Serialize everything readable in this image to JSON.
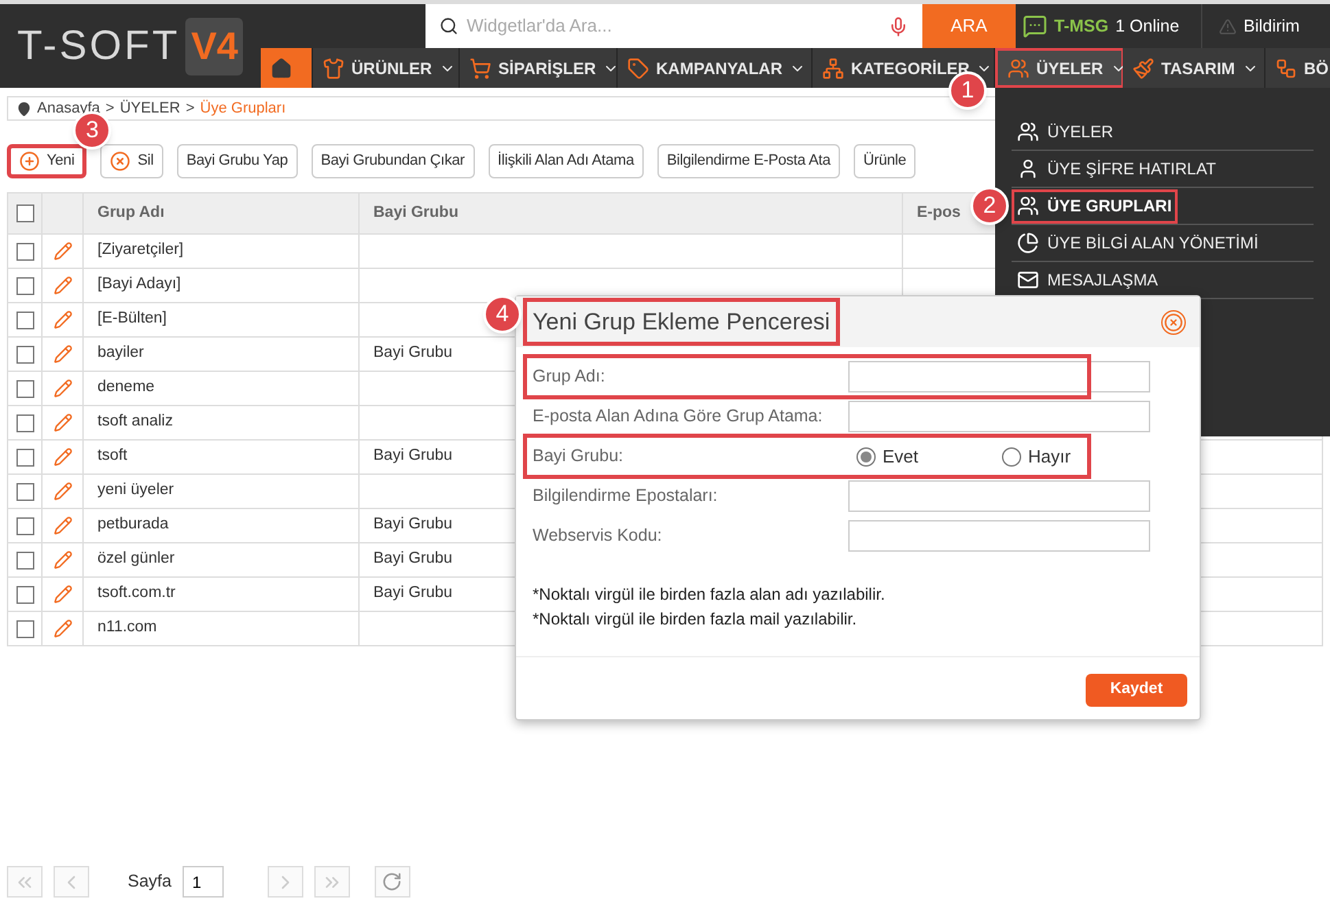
{
  "header": {
    "logo": {
      "text": "T-SOFT",
      "version": "V4"
    },
    "search": {
      "placeholder": "Widgetlar'da Ara..."
    },
    "search_button": "ARA",
    "messages": {
      "label": "T-MSG",
      "status": "1 Online"
    },
    "notifications": "Bildirim"
  },
  "nav": [
    {
      "kind": "home",
      "open": false,
      "caret": false,
      "framed": false
    },
    {
      "kind": "products",
      "label": "ÜRÜNLER",
      "open": false,
      "caret": true,
      "framed": false
    },
    {
      "kind": "orders",
      "label": "SİPARİŞLER",
      "open": false,
      "caret": true,
      "framed": false
    },
    {
      "kind": "campaigns",
      "label": "KAMPANYALAR",
      "open": false,
      "caret": true,
      "framed": false
    },
    {
      "kind": "categories",
      "label": "KATEGORİLER",
      "open": false,
      "caret": true,
      "framed": false
    },
    {
      "kind": "members",
      "label": "ÜYELER",
      "open": true,
      "caret": true,
      "framed": true,
      "badge": "1"
    },
    {
      "kind": "design",
      "label": "TASARIM",
      "open": false,
      "caret": true,
      "framed": false
    },
    {
      "kind": "sitemap",
      "label": "BÖ",
      "open": false,
      "framed": false
    }
  ],
  "breadcrumb": {
    "separator": ">",
    "items": [
      {
        "label": "Anasayfa",
        "current": false
      },
      {
        "label": "ÜYELER",
        "current": false
      },
      {
        "label": "Üye Grupları",
        "current": true
      }
    ]
  },
  "toolbar": [
    {
      "kind": "add",
      "label": "Yeni",
      "framed": true,
      "badge": "3"
    },
    {
      "kind": "delete",
      "label": "Sil",
      "framed": false
    },
    {
      "kind": "plain",
      "label": "Bayi Grubu Yap",
      "framed": false
    },
    {
      "kind": "plain",
      "label": "Bayi Grubundan Çıkar",
      "framed": false
    },
    {
      "kind": "plain",
      "label": "İlişkili Alan Adı Atama",
      "framed": false
    },
    {
      "kind": "plain",
      "label": "Bilgilendirme E-Posta Ata",
      "framed": false
    },
    {
      "kind": "plain",
      "label": "Ürünle",
      "framed": false
    }
  ],
  "table": {
    "all_checked": false,
    "columns": [
      "Grup Adı",
      "Bayi Grubu",
      "E-pos"
    ],
    "rows": [
      {
        "name": "[Ziyaretçiler]",
        "dealer_group": "",
        "checked": false
      },
      {
        "name": "[Bayi Adayı]",
        "dealer_group": "",
        "checked": false
      },
      {
        "name": "[E-Bülten]",
        "dealer_group": "",
        "checked": false
      },
      {
        "name": "bayiler",
        "dealer_group": "Bayi Grubu",
        "checked": false
      },
      {
        "name": "deneme",
        "dealer_group": "",
        "checked": false
      },
      {
        "name": "tsoft analiz",
        "dealer_group": "",
        "checked": false
      },
      {
        "name": "tsoft",
        "dealer_group": "Bayi Grubu",
        "checked": false
      },
      {
        "name": "yeni üyeler",
        "dealer_group": "",
        "checked": false
      },
      {
        "name": "petburada",
        "dealer_group": "Bayi Grubu",
        "checked": false
      },
      {
        "name": "özel günler",
        "dealer_group": "Bayi Grubu",
        "checked": false
      },
      {
        "name": "tsoft.com.tr",
        "dealer_group": "Bayi Grubu",
        "checked": false
      },
      {
        "name": "n11.com",
        "dealer_group": "",
        "checked": false
      }
    ]
  },
  "pagination": {
    "label": "Sayfa",
    "page": "1"
  },
  "dropdown": [
    {
      "kind": "members",
      "label": "ÜYELER",
      "selected": false,
      "framed": false
    },
    {
      "kind": "password",
      "label": "ÜYE ŞİFRE HATIRLAT",
      "selected": false,
      "framed": false
    },
    {
      "kind": "groups",
      "label": "ÜYE GRUPLARI",
      "selected": true,
      "framed": true,
      "badge": "2"
    },
    {
      "kind": "fields",
      "label": "ÜYE BİLGİ ALAN YÖNETİMİ",
      "selected": false,
      "framed": false
    },
    {
      "kind": "messages",
      "label": "MESAJLAŞMA",
      "selected": false,
      "framed": false
    }
  ],
  "dialog": {
    "title": "Yeni Grup Ekleme Penceresi",
    "title_framed": true,
    "title_badge": "4",
    "fields": [
      {
        "kind": "text",
        "label": "Grup Adı:",
        "framed": true
      },
      {
        "kind": "text",
        "label": "E-posta Alan Adına Göre Grup Atama:",
        "framed": false
      },
      {
        "kind": "radio",
        "label": "Bayi Grubu:",
        "framed": true,
        "options": [
          {
            "label": "Evet",
            "selected": true
          },
          {
            "label": "Hayır",
            "selected": false
          }
        ]
      },
      {
        "kind": "text",
        "label": "Bilgilendirme Epostaları:",
        "framed": false
      },
      {
        "kind": "text",
        "label": "Webservis Kodu:",
        "framed": false
      }
    ],
    "notes": [
      "*Noktalı virgül ile birden fazla alan adı yazılabilir.",
      "*Noktalı virgül ile birden fazla mail yazılabilir."
    ],
    "save_button": "Kaydet"
  }
}
